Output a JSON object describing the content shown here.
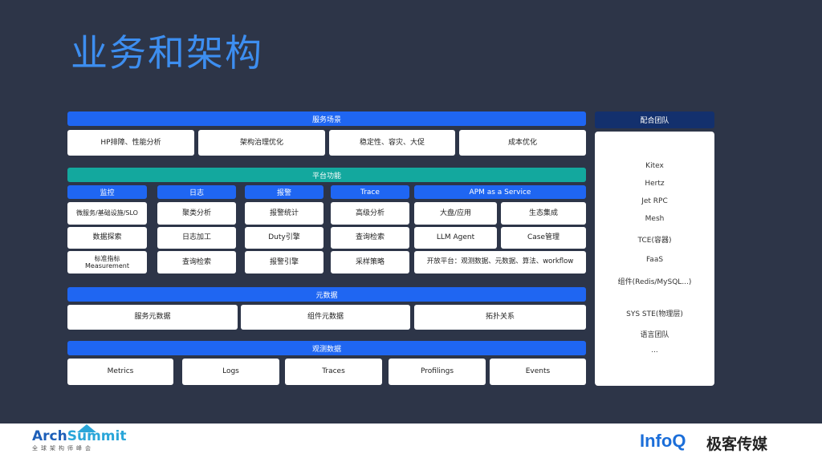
{
  "title": "业务和架构",
  "scenario": {
    "header": "服务场景",
    "items": [
      "HP排障、性能分析",
      "架构治理优化",
      "稳定性、容灾、大促",
      "成本优化"
    ]
  },
  "platform": {
    "header": "平台功能",
    "columns": [
      {
        "header": "监控",
        "items": [
          "微服务/基础设施/SLO",
          "数据探索",
          "标准指标 Measurement"
        ]
      },
      {
        "header": "日志",
        "items": [
          "聚类分析",
          "日志加工",
          "查询检索"
        ]
      },
      {
        "header": "报警",
        "items": [
          "报警统计",
          "Duty引擎",
          "报警引擎"
        ]
      },
      {
        "header": "Trace",
        "items": [
          "高级分析",
          "查询检索",
          "采样策略"
        ]
      }
    ],
    "apm": {
      "header": "APM as a Service",
      "items": [
        "大盘/应用",
        "生态集成",
        "LLM Agent",
        "Case管理"
      ],
      "wide_item": "开放平台：观测数据、元数据、算法、workflow"
    }
  },
  "metadata": {
    "header": "元数据",
    "items": [
      "服务元数据",
      "组件元数据",
      "拓扑关系"
    ]
  },
  "observability": {
    "header": "观测数据",
    "items": [
      "Metrics",
      "Logs",
      "Traces",
      "Profilings",
      "Events"
    ]
  },
  "team": {
    "header": "配合团队",
    "items": [
      "Kitex",
      "Hertz",
      "Jet RPC",
      "Mesh",
      "TCE(容器)",
      "FaaS",
      "组件(Redis/MySQL...)",
      "SYS STE(物理层)",
      "语言团队",
      "..."
    ]
  },
  "footer": {
    "archsummit_a": "Arch",
    "archsummit_b": "Summit",
    "archsummit_sub": "全球架构师峰会",
    "infoq_a": "Info",
    "infoq_b": "Q",
    "geek": "极客传媒"
  },
  "colors": {
    "background": "#2d3548",
    "title": "#3d8ef0",
    "blue_bar": "#1f66f2",
    "teal_bar": "#13a89e",
    "navy_bar": "#13306d",
    "box": "#ffffff"
  }
}
